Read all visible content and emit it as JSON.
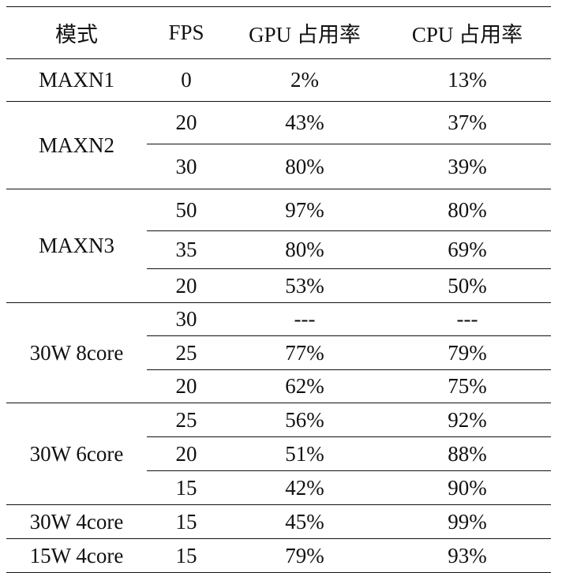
{
  "table": {
    "headers": [
      "模式",
      "FPS",
      "GPU 占用率",
      "CPU 占用率"
    ],
    "groups": [
      {
        "mode": "MAXN1",
        "rows": [
          [
            "0",
            "2%",
            "13%"
          ]
        ]
      },
      {
        "mode": "MAXN2",
        "rows": [
          [
            "20",
            "43%",
            "37%"
          ],
          [
            "30",
            "80%",
            "39%"
          ]
        ]
      },
      {
        "mode": "MAXN3",
        "rows": [
          [
            "50",
            "97%",
            "80%"
          ],
          [
            "35",
            "80%",
            "69%"
          ],
          [
            "20",
            "53%",
            "50%"
          ]
        ]
      },
      {
        "mode": "30W 8core",
        "rows": [
          [
            "30",
            "---",
            "---"
          ],
          [
            "25",
            "77%",
            "79%"
          ],
          [
            "20",
            "62%",
            "75%"
          ]
        ]
      },
      {
        "mode": "30W 6core",
        "rows": [
          [
            "25",
            "56%",
            "92%"
          ],
          [
            "20",
            "51%",
            "88%"
          ],
          [
            "15",
            "42%",
            "90%"
          ]
        ]
      },
      {
        "mode": "30W 4core",
        "rows": [
          [
            "15",
            "45%",
            "99%"
          ]
        ]
      },
      {
        "mode": "15W 4core",
        "rows": [
          [
            "15",
            "79%",
            "93%"
          ]
        ]
      }
    ]
  }
}
